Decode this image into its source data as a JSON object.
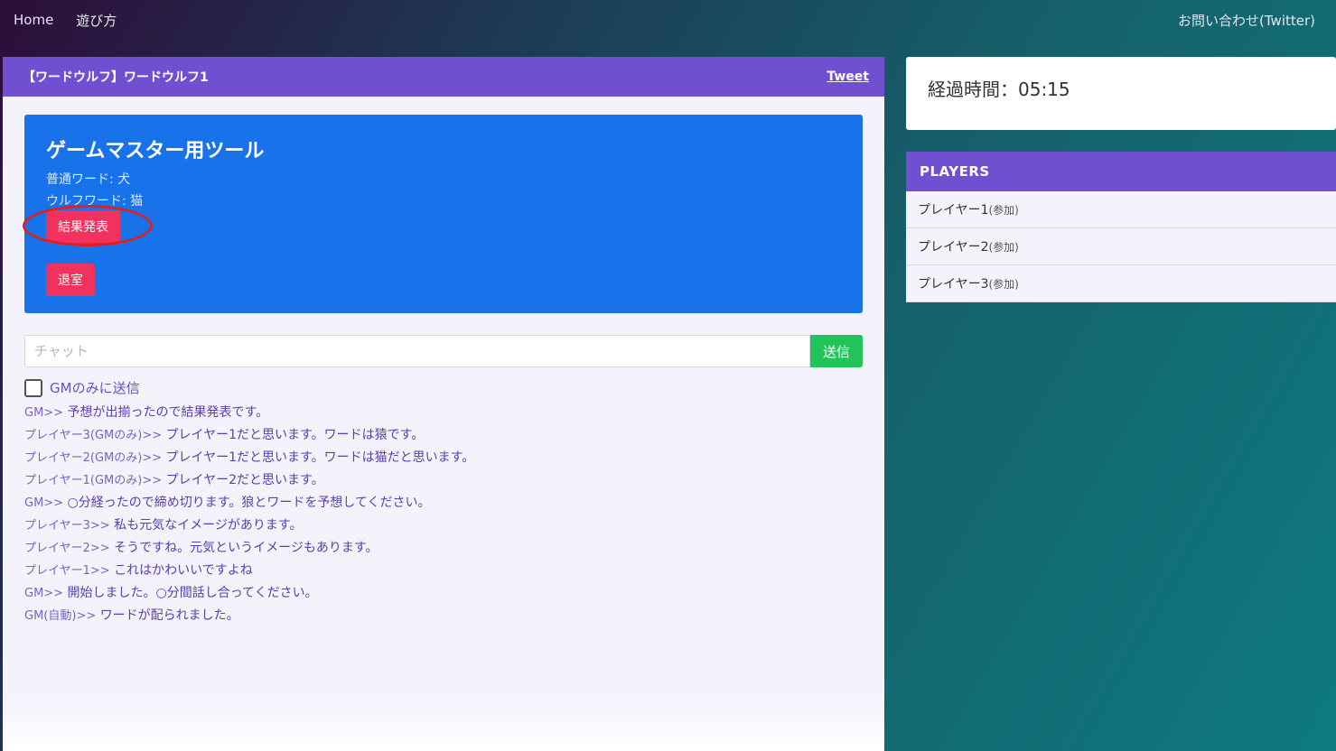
{
  "nav": {
    "home": "Home",
    "howto": "遊び方",
    "contact": "お問い合わせ(Twitter)"
  },
  "room": {
    "title": "【ワードウルフ】ワードウルフ1",
    "tweet": "Tweet"
  },
  "gm_tool": {
    "title": "ゲームマスター用ツール",
    "normal_word": "普通ワード: 犬",
    "wolf_word": "ウルフワード: 猫",
    "result_button": "結果発表",
    "exit_button": "退室"
  },
  "chat": {
    "placeholder": "チャット",
    "send_label": "送信",
    "gm_only_label": "GMのみに送信"
  },
  "messages": [
    {
      "sender": "GM>>",
      "text": "予想が出揃ったので結果発表です。"
    },
    {
      "sender": "プレイヤー3(GMのみ)>>",
      "text": "プレイヤー1だと思います。ワードは猿です。"
    },
    {
      "sender": "プレイヤー2(GMのみ)>>",
      "text": "プレイヤー1だと思います。ワードは猫だと思います。"
    },
    {
      "sender": "プレイヤー1(GMのみ)>>",
      "text": "プレイヤー2だと思います。"
    },
    {
      "sender": "GM>>",
      "text": "○分経ったので締め切ります。狼とワードを予想してください。"
    },
    {
      "sender": "プレイヤー3>>",
      "text": "私も元気なイメージがあります。"
    },
    {
      "sender": "プレイヤー2>>",
      "text": "そうですね。元気というイメージもあります。"
    },
    {
      "sender": "プレイヤー1>>",
      "text": "これはかわいいですよね"
    },
    {
      "sender": "GM>>",
      "text": "開始しました。○分間話し合ってください。"
    },
    {
      "sender": "GM(自動)>>",
      "text": "ワードが配られました。"
    }
  ],
  "timer": {
    "label": "経過時間：05:15"
  },
  "players": {
    "header": "PLAYERS",
    "list": [
      {
        "name": "プレイヤー1",
        "status": "(参加)"
      },
      {
        "name": "プレイヤー2",
        "status": "(参加)"
      },
      {
        "name": "プレイヤー3",
        "status": "(参加)"
      }
    ]
  },
  "colors": {
    "accent_purple": "#7050d0",
    "gm_box_blue": "#1873ea",
    "danger_red": "#f2325e",
    "send_green": "#22c45a",
    "highlight_red": "#e02020"
  }
}
